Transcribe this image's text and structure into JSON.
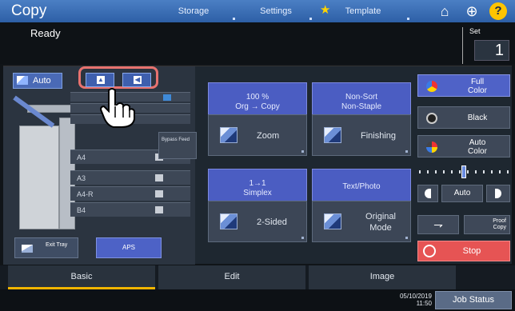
{
  "header": {
    "title": "Copy",
    "tabs": {
      "storage": "Storage",
      "settings": "Settings",
      "template": "Template"
    }
  },
  "status": {
    "text": "Ready",
    "set_label": "Set",
    "set_value": "1"
  },
  "machine": {
    "auto_label": "Auto",
    "trays": [
      "A4",
      "A3",
      "A4-R",
      "B4"
    ],
    "bypass_label": "Bypass Feed",
    "exit_tray_label": "Exit Tray",
    "aps_label": "APS"
  },
  "functions": {
    "zoom": {
      "ratio": "100 %",
      "flow": "Org → Copy",
      "button": "Zoom"
    },
    "finishing": {
      "line1": "Non-Sort",
      "line2": "Non-Staple",
      "button": "Finishing"
    },
    "duplex": {
      "line1": "1→1",
      "line2": "Simplex",
      "button": "2-Sided"
    },
    "original": {
      "label": "Text/Photo",
      "line1": "Original",
      "line2": "Mode"
    }
  },
  "color": {
    "full_color_1": "Full",
    "full_color_2": "Color",
    "black": "Black",
    "auto_color_1": "Auto",
    "auto_color_2": "Color",
    "density_auto": "Auto",
    "density_level": 0.5
  },
  "controls": {
    "proof_1": "Proof",
    "proof_2": "Copy",
    "stop": "Stop"
  },
  "bottom_tabs": {
    "basic": "Basic",
    "edit": "Edit",
    "image": "Image"
  },
  "footer": {
    "date": "05/10/2019",
    "time": "11:50",
    "job_status": "Job Status"
  },
  "colors": {
    "accent": "#4b5dc2",
    "highlight": "#e7726f",
    "stop": "#e65454",
    "tab_active": "#f0b400"
  }
}
